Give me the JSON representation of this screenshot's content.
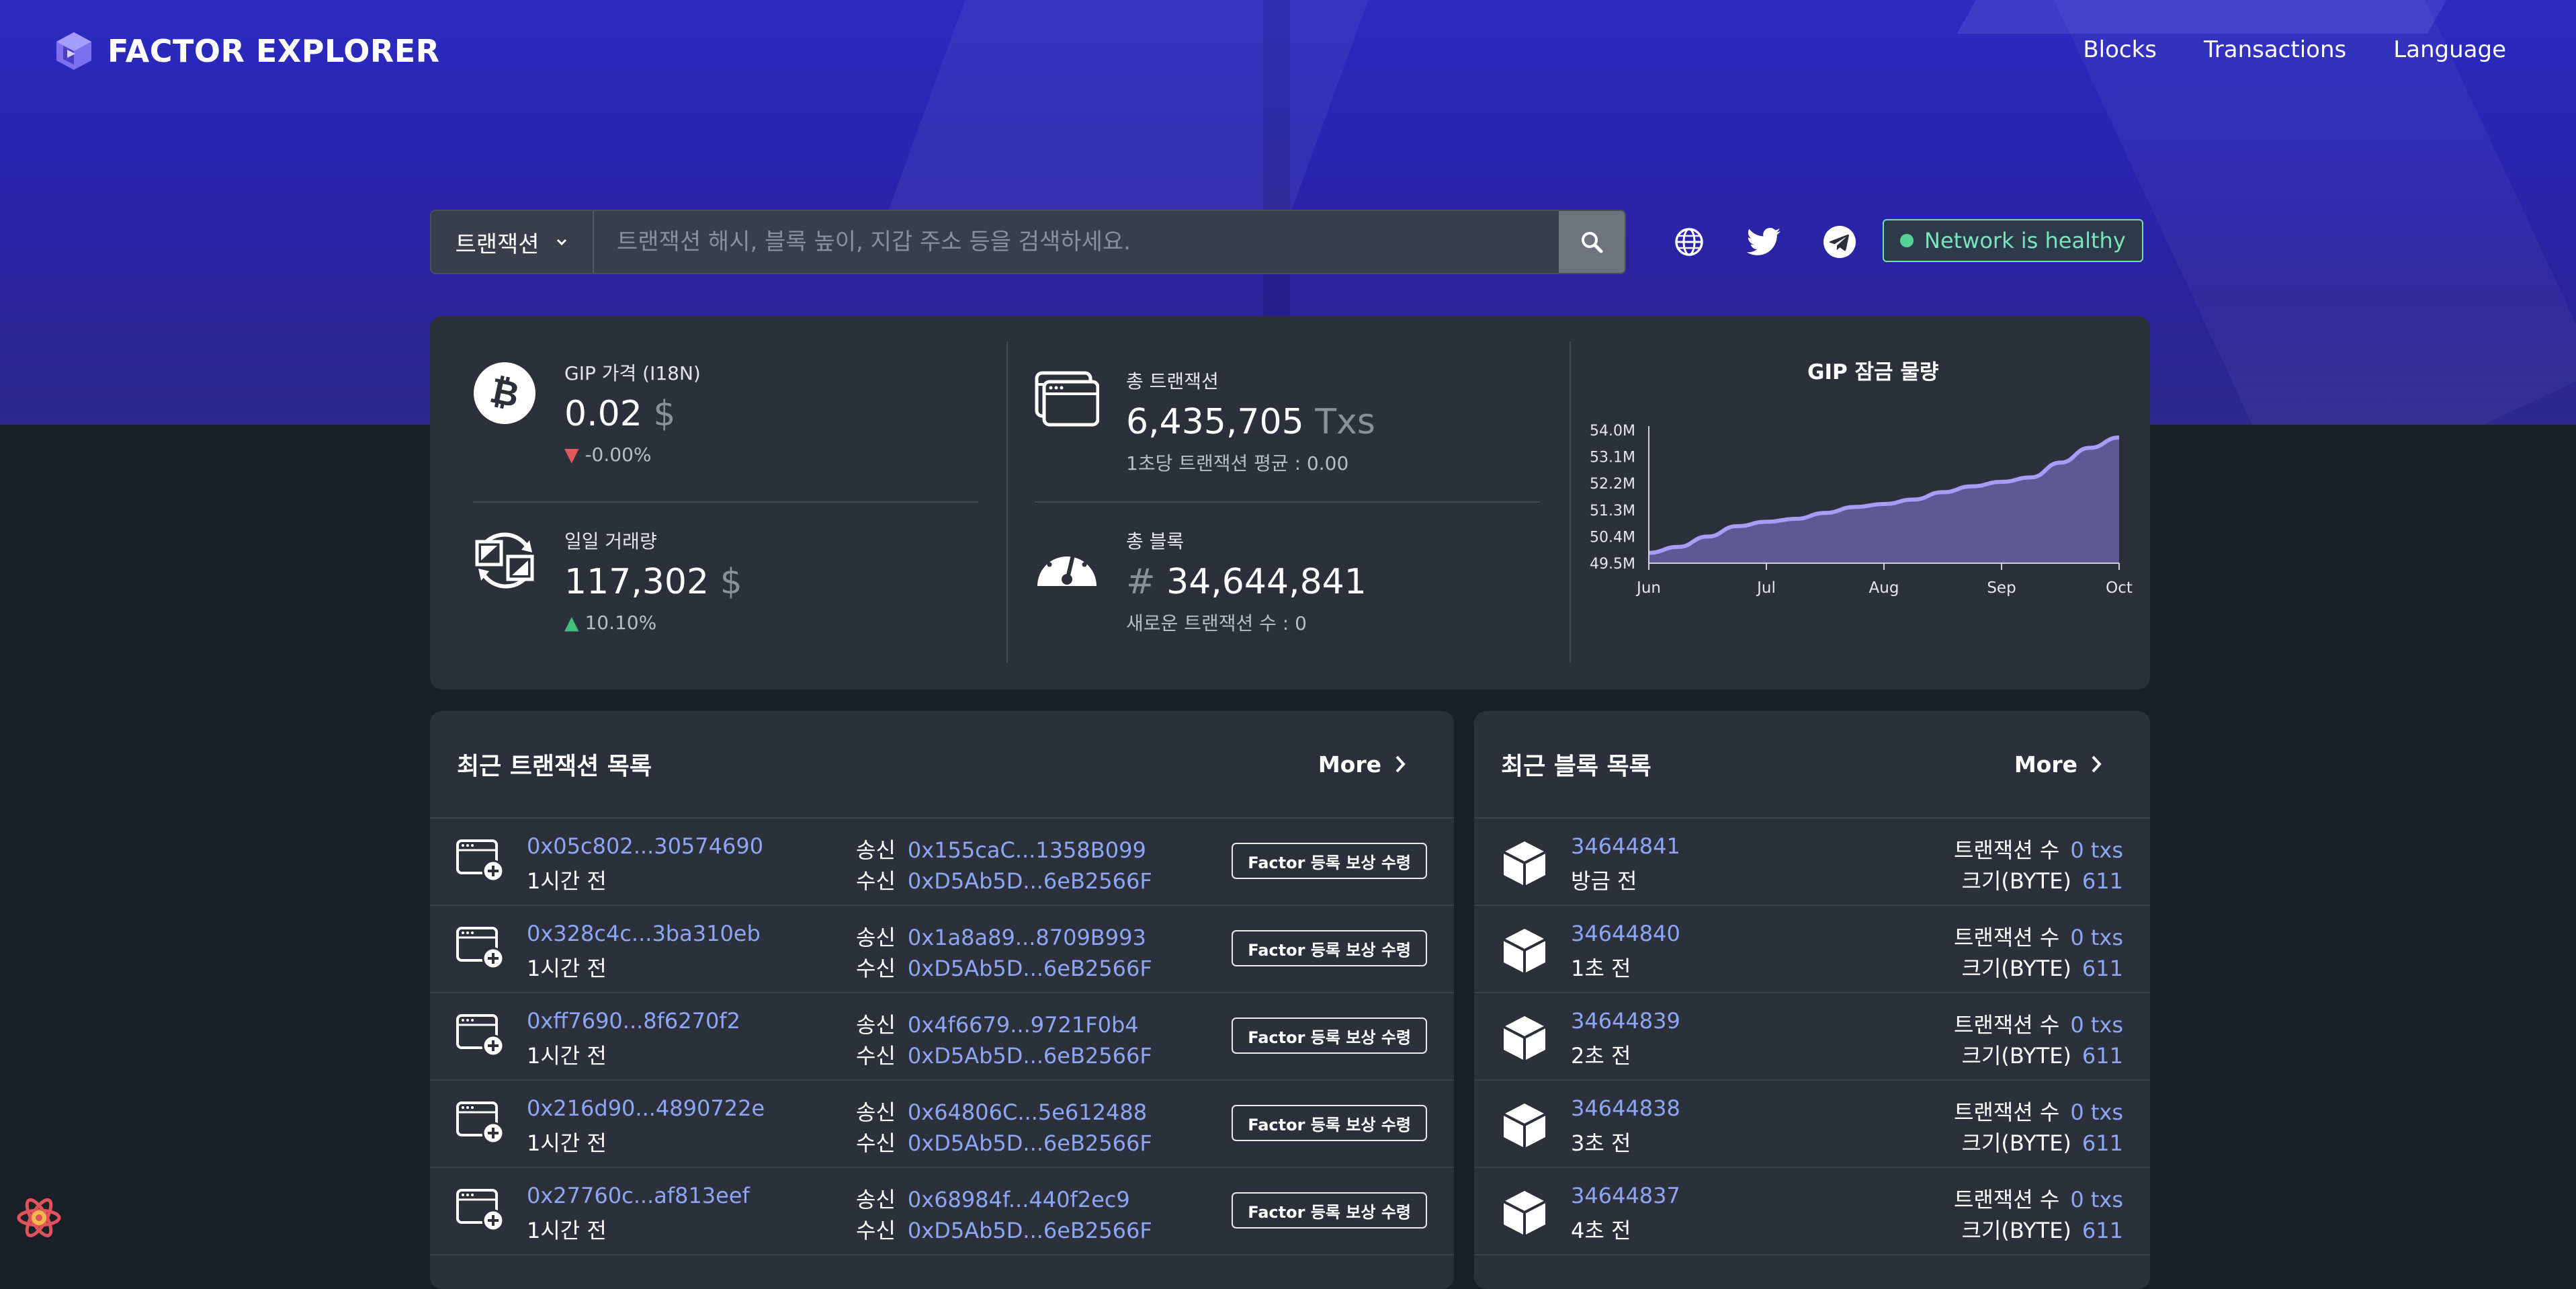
{
  "brand": {
    "name": "FACTOR EXPLORER"
  },
  "nav": {
    "items": [
      "Blocks",
      "Transactions",
      "Language"
    ]
  },
  "search": {
    "type_label": "트랜잭션",
    "placeholder": "트랜잭션 해시, 블록 높이, 지갑 주소 등을 검색하세요."
  },
  "network": {
    "status": "Network is healthy",
    "status_color": "#54d49b"
  },
  "stats": {
    "price": {
      "label": "GIP 가격 (I18N)",
      "value": "0.02",
      "unit": "$",
      "change": "-0.00%",
      "direction": "down"
    },
    "volume": {
      "label": "일일 거래량",
      "value": "117,302",
      "unit": "$",
      "change": "10.10%",
      "direction": "up"
    },
    "txs": {
      "label": "총 트랜잭션",
      "value": "6,435,705",
      "unit": "Txs",
      "sub": "1초당 트랜잭션 평균 : 0.00"
    },
    "blocks": {
      "label": "총 블록",
      "prefix": "#",
      "value": "34,644,841",
      "sub": "새로운 트랜잭션 수 : 0"
    }
  },
  "chart_data": {
    "type": "area",
    "title": "GIP 잠금 물량",
    "categories": [
      "Jun",
      "Jul",
      "Aug",
      "Sep",
      "Oct"
    ],
    "yticks": [
      "54.0M",
      "53.1M",
      "52.2M",
      "51.3M",
      "50.4M",
      "49.5M"
    ],
    "x": [
      0,
      0.25,
      0.5,
      0.75,
      1.0,
      1.25,
      1.5,
      1.75,
      2.0,
      2.25,
      2.5,
      2.75,
      3.0,
      3.25,
      3.5,
      3.75,
      4.0
    ],
    "values": [
      49.85,
      50.05,
      50.4,
      50.75,
      50.9,
      51.0,
      51.2,
      51.4,
      51.5,
      51.65,
      51.9,
      52.1,
      52.25,
      52.4,
      52.9,
      53.4,
      53.75
    ],
    "ylim": [
      49.5,
      54.0
    ],
    "series": [
      {
        "values": [
          49.85,
          50.05,
          50.4,
          50.75,
          50.9,
          51.0,
          51.2,
          51.4,
          51.5,
          51.65,
          51.9,
          52.1,
          52.25,
          52.4,
          52.9,
          53.4,
          53.75
        ]
      }
    ],
    "line_color": "#a89cf7",
    "fill_color": "#6f66b3",
    "grid": false
  },
  "tx_panel": {
    "title": "최근 트랜잭션 목록",
    "more_label": "More",
    "from_label": "송신",
    "to_label": "수신",
    "rows": [
      {
        "hash": "0x05c802...30574690",
        "time": "1시간 전",
        "from": "0x155caC...1358B099",
        "to": "0xD5Ab5D...6eB2566F",
        "badge": "Factor 등록 보상 수령"
      },
      {
        "hash": "0x328c4c...3ba310eb",
        "time": "1시간 전",
        "from": "0x1a8a89...8709B993",
        "to": "0xD5Ab5D...6eB2566F",
        "badge": "Factor 등록 보상 수령"
      },
      {
        "hash": "0xff7690...8f6270f2",
        "time": "1시간 전",
        "from": "0x4f6679...9721F0b4",
        "to": "0xD5Ab5D...6eB2566F",
        "badge": "Factor 등록 보상 수령"
      },
      {
        "hash": "0x216d90...4890722e",
        "time": "1시간 전",
        "from": "0x64806C...5e612488",
        "to": "0xD5Ab5D...6eB2566F",
        "badge": "Factor 등록 보상 수령"
      },
      {
        "hash": "0x27760c...af813eef",
        "time": "1시간 전",
        "from": "0x68984f...440f2ec9",
        "to": "0xD5Ab5D...6eB2566F",
        "badge": "Factor 등록 보상 수령"
      }
    ]
  },
  "block_panel": {
    "title": "최근 블록 목록",
    "more_label": "More",
    "tx_count_label": "트랜잭션 수",
    "size_label": "크기(BYTE)",
    "rows": [
      {
        "number": "34644841",
        "time": "방금 전",
        "txs": "0 txs",
        "size": "611"
      },
      {
        "number": "34644840",
        "time": "1초 전",
        "txs": "0 txs",
        "size": "611"
      },
      {
        "number": "34644839",
        "time": "2초 전",
        "txs": "0 txs",
        "size": "611"
      },
      {
        "number": "34644838",
        "time": "3초 전",
        "txs": "0 txs",
        "size": "611"
      },
      {
        "number": "34644837",
        "time": "4초 전",
        "txs": "0 txs",
        "size": "611"
      }
    ]
  }
}
